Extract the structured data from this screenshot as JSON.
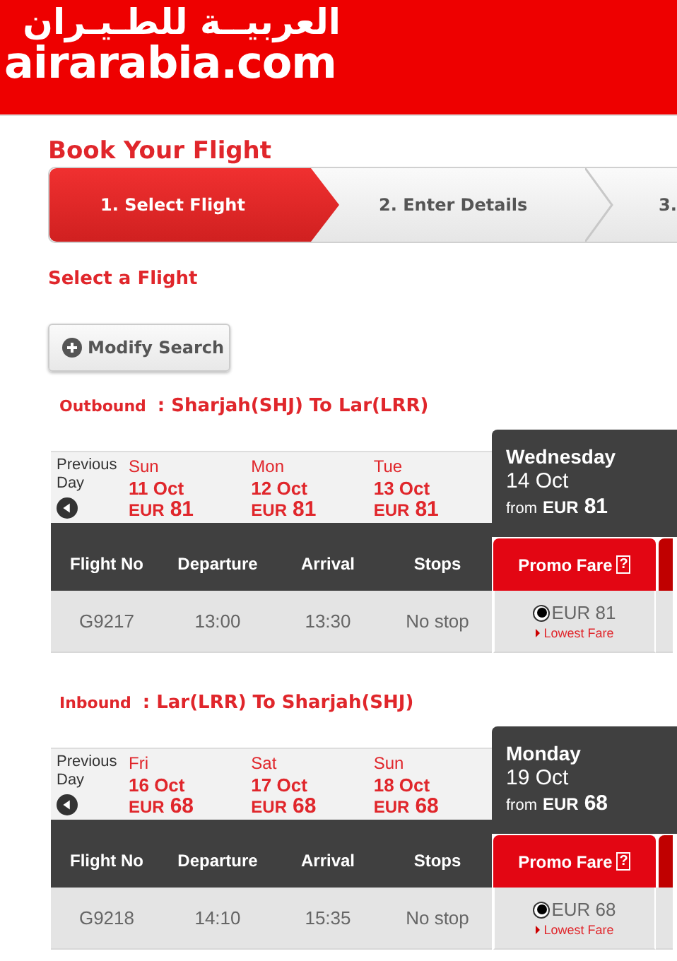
{
  "logo": {
    "arabic": "العربيــة للطـيـران",
    "latin": "airarabia.com"
  },
  "title": "Book Your Flight",
  "steps": [
    {
      "label": "1. Select Flight",
      "selected": true
    },
    {
      "label": "2. Enter Details",
      "selected": false
    },
    {
      "label": "3.",
      "selected": false
    }
  ],
  "subtitle": "Select a Flight",
  "modify_button": "Modify Search",
  "legs": [
    {
      "direction": "Outbound",
      "route": ": Sharjah(SHJ) To Lar(LRR)",
      "previous_day": "Previous Day",
      "dates": [
        {
          "day": "Sun",
          "date": "11 Oct",
          "currency": "EUR",
          "price": "81",
          "selected": false
        },
        {
          "day": "Mon",
          "date": "12 Oct",
          "currency": "EUR",
          "price": "81",
          "selected": false
        },
        {
          "day": "Tue",
          "date": "13 Oct",
          "currency": "EUR",
          "price": "81",
          "selected": false
        },
        {
          "day": "Wednesday",
          "date": "14 Oct",
          "from": "from",
          "currency": "EUR",
          "price": "81",
          "selected": true
        }
      ],
      "columns": [
        "Flight No",
        "Departure",
        "Arrival",
        "Stops"
      ],
      "fare_header": "Promo Fare",
      "fare_help": "?",
      "flights": [
        {
          "flight_no": "G9217",
          "departure": "13:00",
          "arrival": "13:30",
          "stops": "No stop",
          "fare": "EUR 81",
          "selected": true,
          "note": "Lowest Fare"
        }
      ]
    },
    {
      "direction": "Inbound",
      "route": ": Lar(LRR) To Sharjah(SHJ)",
      "previous_day": "Previous Day",
      "dates": [
        {
          "day": "Fri",
          "date": "16 Oct",
          "currency": "EUR",
          "price": "68",
          "selected": false
        },
        {
          "day": "Sat",
          "date": "17 Oct",
          "currency": "EUR",
          "price": "68",
          "selected": false
        },
        {
          "day": "Sun",
          "date": "18 Oct",
          "currency": "EUR",
          "price": "68",
          "selected": false
        },
        {
          "day": "Monday",
          "date": "19 Oct",
          "from": "from",
          "currency": "EUR",
          "price": "68",
          "selected": true
        }
      ],
      "columns": [
        "Flight No",
        "Departure",
        "Arrival",
        "Stops"
      ],
      "fare_header": "Promo Fare",
      "fare_help": "?",
      "flights": [
        {
          "flight_no": "G9218",
          "departure": "14:10",
          "arrival": "15:35",
          "stops": "No stop",
          "fare": "EUR 68",
          "selected": true,
          "note": "Lowest Fare"
        }
      ]
    }
  ]
}
